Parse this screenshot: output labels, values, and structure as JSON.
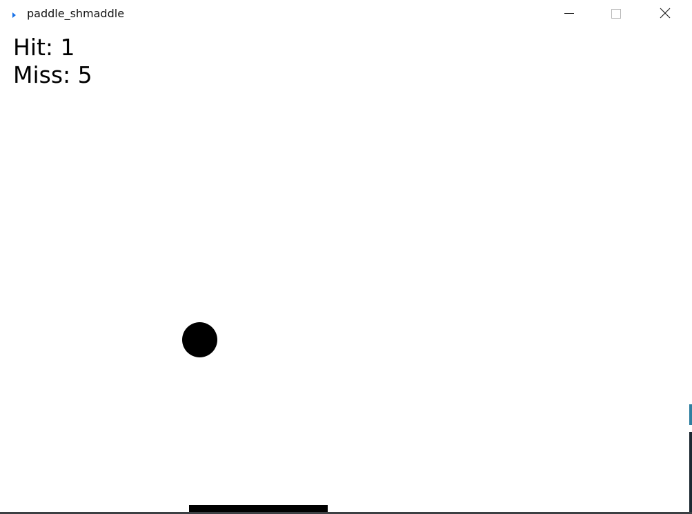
{
  "window": {
    "title": "paddle_shmaddle",
    "controls": {
      "minimize_icon": "minimize-icon",
      "maximize_icon": "maximize-icon",
      "close_icon": "close-icon"
    }
  },
  "game": {
    "hit_text": "Hit: 1",
    "miss_text": "Miss: 5",
    "hit": 1,
    "miss": 5
  },
  "colors": {
    "background": "#ffffff",
    "foreground": "#000000",
    "app_icon": "#1a73e8"
  },
  "icons": {
    "app": "app-play-icon"
  }
}
